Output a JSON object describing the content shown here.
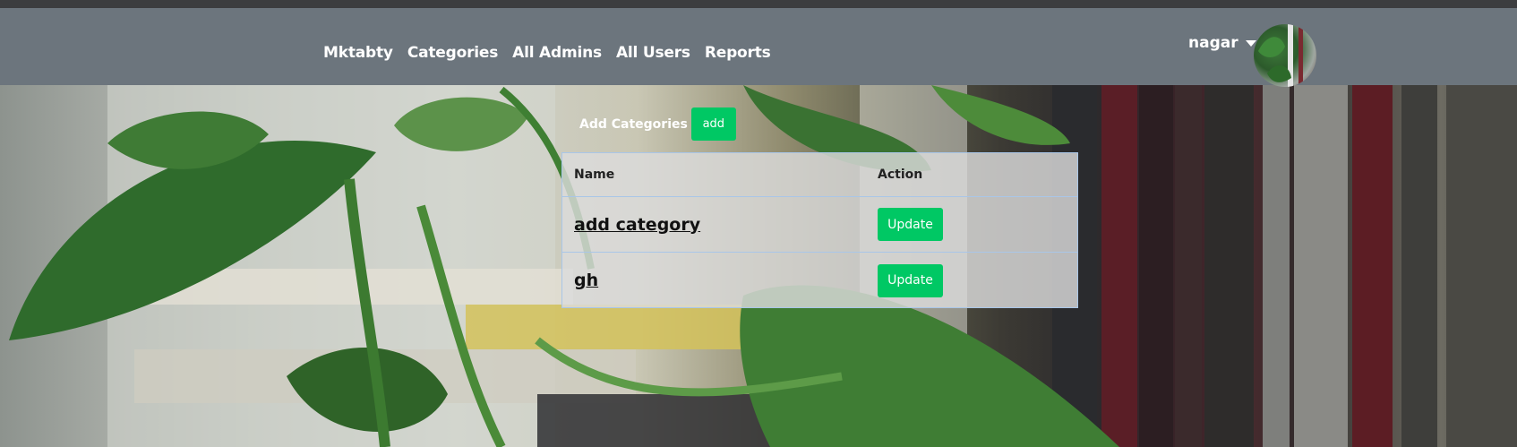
{
  "nav": {
    "links": [
      "Mktabty",
      "Categories",
      "All Admins",
      "All Users",
      "Reports"
    ],
    "user_name": "nagar"
  },
  "page": {
    "add_label": "Add Categories",
    "add_button": "add"
  },
  "table": {
    "headers": [
      "Name",
      "Action"
    ],
    "rows": [
      {
        "name": "add category",
        "action": "Update"
      },
      {
        "name": "gh",
        "action": "Update"
      }
    ]
  },
  "colors": {
    "navbar": "#6c757d",
    "button_green": "#00c864",
    "table_border": "#a9c6e8"
  },
  "icons": [
    "caret-down-icon",
    "user-avatar"
  ]
}
